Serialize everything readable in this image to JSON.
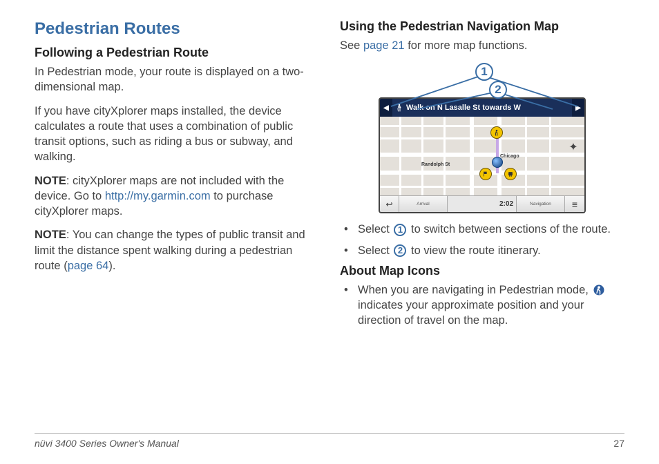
{
  "left": {
    "heading": "Pedestrian Routes",
    "sub1": "Following a Pedestrian Route",
    "p1": "In Pedestrian mode, your route is displayed on a two-dimensional map.",
    "p2": "If you have cityXplorer maps installed, the device calculates a route that uses a combination of public transit options, such as riding a bus or subway, and walking.",
    "note1_label": "NOTE",
    "note1a": ": cityXplorer maps are not included with the device. Go to ",
    "note1_link": "http://my.garmin.com",
    "note1b": " to purchase cityXplorer maps.",
    "note2_label": "NOTE",
    "note2a": ": You can change the types of public transit and limit the distance spent walking during a pedestrian route (",
    "note2_link": "page 64",
    "note2b": ")."
  },
  "right": {
    "sub1": "Using the Pedestrian Navigation Map",
    "see_a": "See ",
    "see_link": "page 21",
    "see_b": " for more map functions.",
    "callout1": "1",
    "callout2": "2",
    "map": {
      "instruction": "Walk on N Lasalle St towards W",
      "street": "Randolph St",
      "bottom_arrival_label": "Arrival",
      "bottom_nav_label": "Navigation",
      "clock": "2:02"
    },
    "bul1a": "Select ",
    "bul1_num": "1",
    "bul1b": " to switch between sections of the route.",
    "bul2a": "Select ",
    "bul2_num": "2",
    "bul2b": " to view the route itinerary.",
    "sub2": "About Map Icons",
    "bul3a": "When you are navigating in Pedestrian mode, ",
    "bul3b": " indicates your approximate position and your direction of travel on the map."
  },
  "footer": {
    "manual": "nüvi 3400 Series Owner's Manual",
    "page": "27"
  }
}
